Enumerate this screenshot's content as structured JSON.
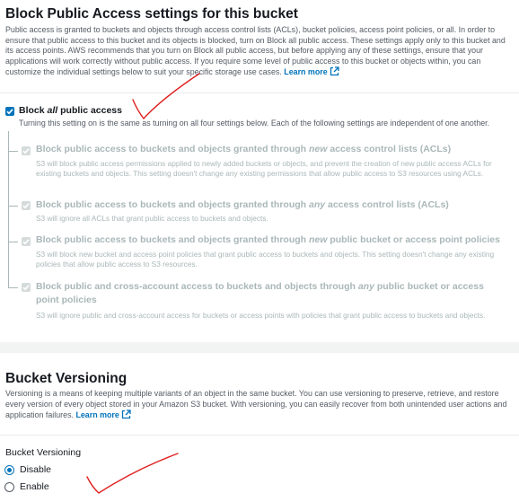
{
  "block_public_access": {
    "title": "Block Public Access settings for this bucket",
    "description": "Public access is granted to buckets and objects through access control lists (ACLs), bucket policies, access point policies, or all. In order to ensure that public access to this bucket and its objects is blocked, turn on Block all public access. These settings apply only to this bucket and its access points. AWS recommends that you turn on Block all public access, but before applying any of these settings, ensure that your applications will work correctly without public access. If you require some level of public access to this bucket or objects within, you can customize the individual settings below to suit your specific storage use cases.",
    "learn_more": "Learn more",
    "main_option": {
      "label_prefix": "Block ",
      "label_italic": "all",
      "label_suffix": " public access",
      "checked": true,
      "description": "Turning this setting on is the same as turning on all four settings below. Each of the following settings are independent of one another."
    },
    "sub_options": [
      {
        "label_prefix": "Block public access to buckets and objects granted through ",
        "label_italic": "new",
        "label_suffix": " access control lists (ACLs)",
        "description": "S3 will block public access permissions applied to newly added buckets or objects, and prevent the creation of new public access ACLs for existing buckets and objects. This setting doesn't change any existing permissions that allow public access to S3 resources using ACLs.",
        "checked": true
      },
      {
        "label_prefix": "Block public access to buckets and objects granted through ",
        "label_italic": "any",
        "label_suffix": " access control lists (ACLs)",
        "description": "S3 will ignore all ACLs that grant public access to buckets and objects.",
        "checked": true
      },
      {
        "label_prefix": "Block public access to buckets and objects granted through ",
        "label_italic": "new",
        "label_suffix": " public bucket or access point policies",
        "description": "S3 will block new bucket and access point policies that grant public access to buckets and objects. This setting doesn't change any existing policies that allow public access to S3 resources.",
        "checked": true
      },
      {
        "label_prefix": "Block public and cross-account access to buckets and objects through ",
        "label_italic": "any",
        "label_suffix": " public bucket or access point policies",
        "description": "S3 will ignore public and cross-account access for buckets or access points with policies that grant public access to buckets and objects.",
        "checked": true
      }
    ]
  },
  "bucket_versioning": {
    "title": "Bucket Versioning",
    "description": "Versioning is a means of keeping multiple variants of an object in the same bucket. You can use versioning to preserve, retrieve, and restore every version of every object stored in your Amazon S3 bucket. With versioning, you can easily recover from both unintended user actions and application failures.",
    "learn_more": "Learn more",
    "field_label": "Bucket Versioning",
    "options": [
      {
        "label": "Disable",
        "selected": true
      },
      {
        "label": "Enable",
        "selected": false
      }
    ]
  },
  "colors": {
    "accent": "#0073bb",
    "annotation": "#e02020",
    "disabled": "#aab7b8"
  }
}
